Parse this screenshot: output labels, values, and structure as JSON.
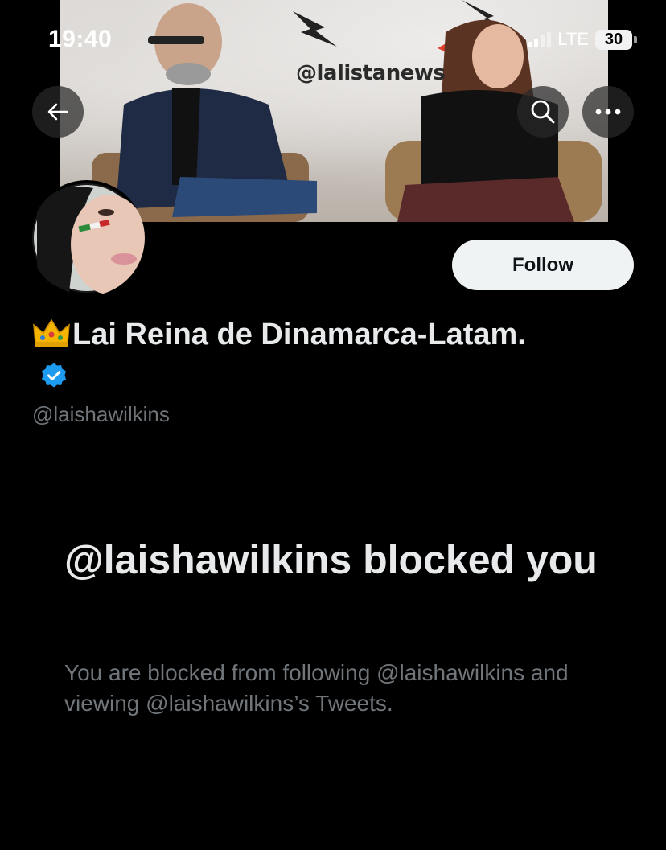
{
  "status_bar": {
    "time": "19:40",
    "network": "LTE",
    "battery": "30"
  },
  "banner": {
    "watermark": "@lalistanews"
  },
  "profile": {
    "display_name": "Lai Reina de Dinamarca-Latam.",
    "handle": "@laishawilkins",
    "verified": true,
    "follow_label": "Follow",
    "name_prefix_emoji": "crown-icon"
  },
  "blocked": {
    "title": "@laishawilkins blocked you",
    "description": "You are blocked from following @laishawilkins and viewing @laishawilkins’s Tweets."
  },
  "icons": {
    "back": "arrow-left-icon",
    "search": "search-icon",
    "more": "more-horizontal-icon",
    "verified": "verified-badge-icon"
  },
  "colors": {
    "background": "#000000",
    "primary_text": "#e7e9ea",
    "secondary_text": "#71767b",
    "verified_blue": "#1d9bf0",
    "follow_button_bg": "#eff3f4"
  }
}
